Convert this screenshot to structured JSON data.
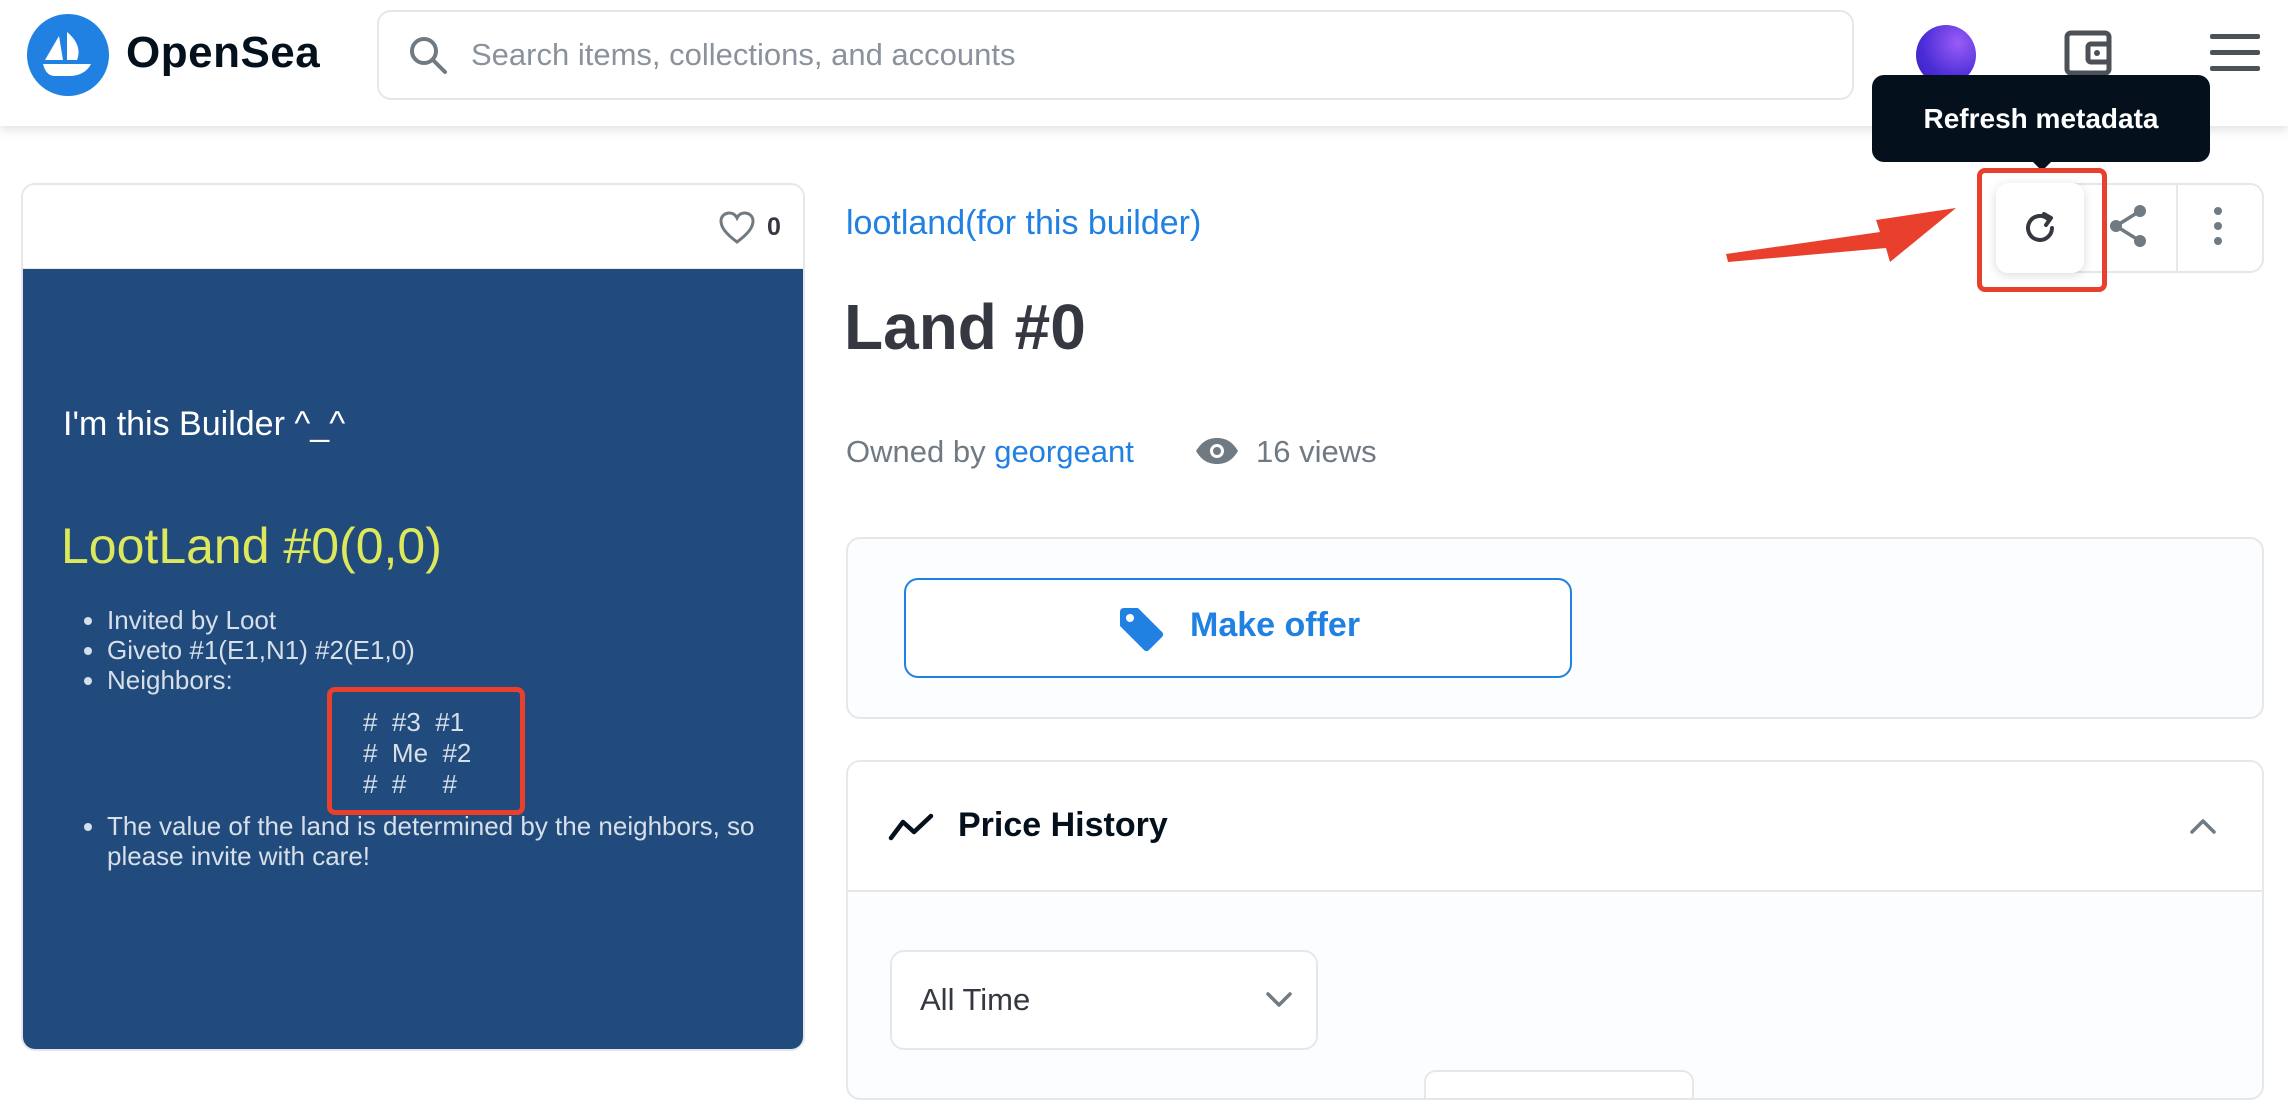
{
  "header": {
    "brand": "OpenSea",
    "search_placeholder": "Search items, collections, and accounts",
    "icons": [
      "opensea-logo-icon",
      "search-icon",
      "wallet-icon",
      "menu-icon"
    ]
  },
  "asset_card": {
    "favorites_count": "0",
    "artwork": {
      "builder_line": "I'm this Builder ^_^",
      "title": "LootLand #0(0,0)",
      "bullets": [
        "Invited by Loot",
        "Giveto #1(E1,N1) #2(E1,0)",
        "Neighbors:"
      ],
      "grid_rows": [
        "#  #3  #1",
        "#  Me  #2",
        "#  #     #"
      ],
      "note": "The value of the land is determined by the neighbors, so please invite with care!",
      "background_color": "#214b7c",
      "title_color": "#dde85a"
    }
  },
  "item": {
    "collection": "lootland(for this builder)",
    "title": "Land #0",
    "owned_by_label": "Owned by",
    "owner": "georgeant",
    "views": "16 views"
  },
  "actions": {
    "tooltip": "Refresh metadata",
    "icons": [
      "refresh-icon",
      "share-icon",
      "more-icon"
    ]
  },
  "offer": {
    "button_label": "Make offer"
  },
  "price_history": {
    "title": "Price History",
    "time_filter": "All Time"
  },
  "colors": {
    "accent": "#2081e2",
    "annotation": "#e8402c",
    "tooltip_bg": "#04111d"
  }
}
